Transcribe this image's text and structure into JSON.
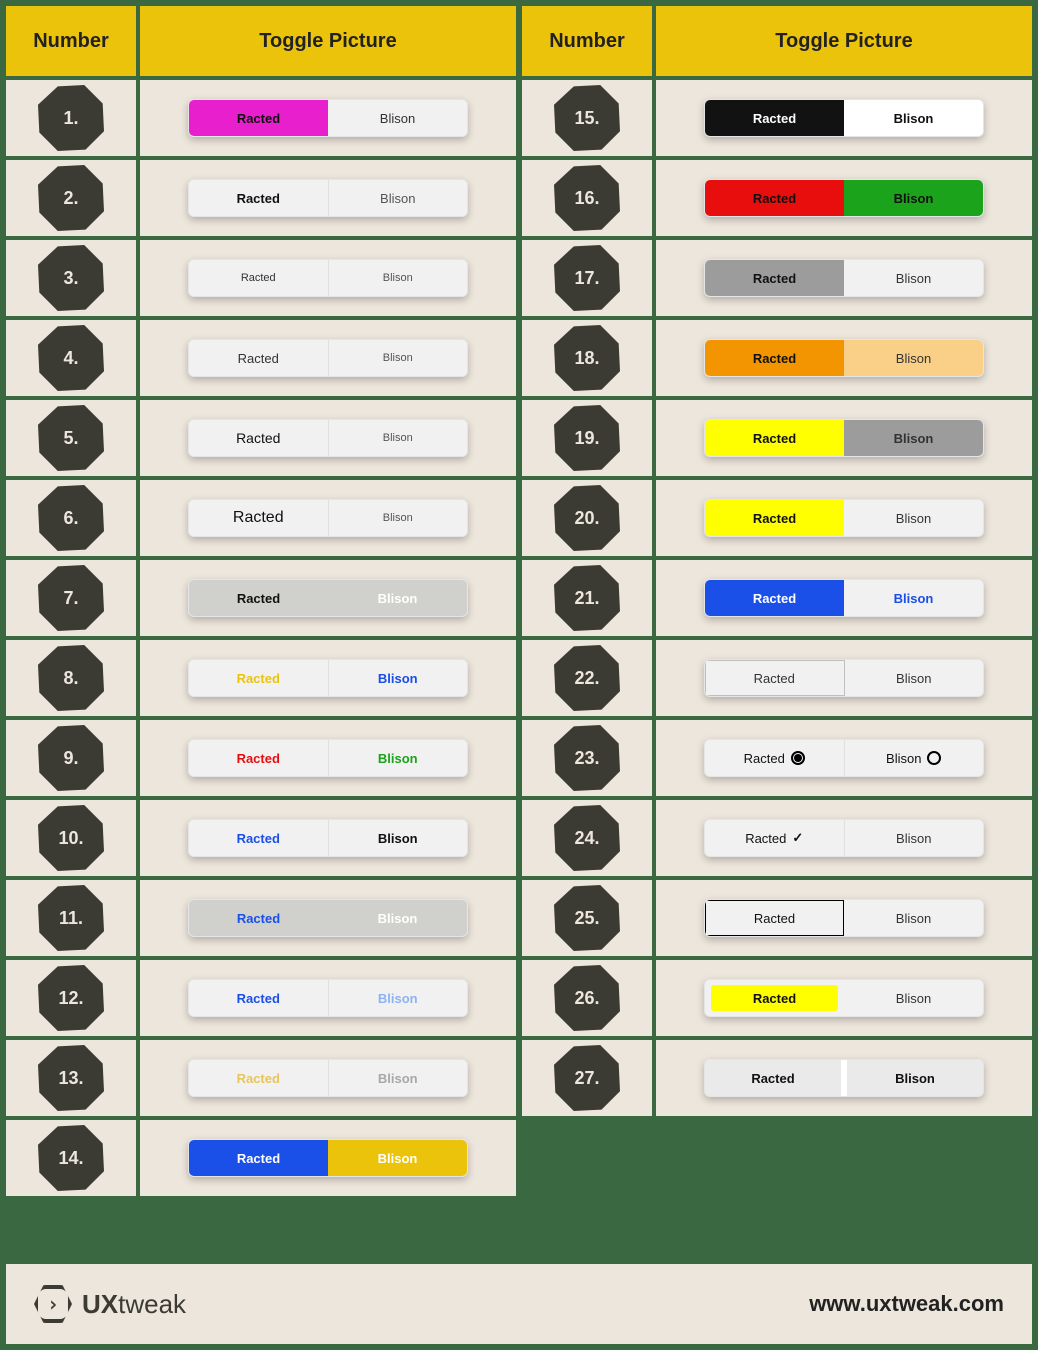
{
  "headers": {
    "number": "Number",
    "picture": "Toggle Picture"
  },
  "opt1": "Racted",
  "opt2": "Blison",
  "rows_left": [
    {
      "n": "1.",
      "left": {
        "bg": "#E81FCD",
        "fg": "#111",
        "fw": "700"
      },
      "right": {
        "bg": "#F1F1F1",
        "fg": "#333",
        "fw": "400"
      }
    },
    {
      "n": "2.",
      "left": {
        "bg": "#F1F1F1",
        "fg": "#111",
        "fw": "700",
        "div": "#E0E0E0"
      },
      "right": {
        "bg": "#F1F1F1",
        "fg": "#555",
        "fw": "400"
      }
    },
    {
      "n": "3.",
      "left": {
        "bg": "#F1F1F1",
        "fg": "#333",
        "fw": "400",
        "fs": "11px",
        "div": "#E0E0E0"
      },
      "right": {
        "bg": "#F1F1F1",
        "fg": "#555",
        "fw": "400",
        "fs": "11px"
      }
    },
    {
      "n": "4.",
      "left": {
        "bg": "#F1F1F1",
        "fg": "#333",
        "fw": "400",
        "div": "#E0E0E0"
      },
      "right": {
        "bg": "#F1F1F1",
        "fg": "#555",
        "fw": "400",
        "fs": "11px"
      }
    },
    {
      "n": "5.",
      "left": {
        "bg": "#F1F1F1",
        "fg": "#111",
        "fw": "400",
        "fs": "14px",
        "div": "#E0E0E0"
      },
      "right": {
        "bg": "#F1F1F1",
        "fg": "#555",
        "fw": "400",
        "fs": "11px"
      }
    },
    {
      "n": "6.",
      "left": {
        "bg": "#F1F1F1",
        "fg": "#111",
        "fw": "400",
        "fs": "16px",
        "div": "#E0E0E0"
      },
      "right": {
        "bg": "#F1F1F1",
        "fg": "#555",
        "fw": "400",
        "fs": "11px"
      }
    },
    {
      "n": "7.",
      "left": {
        "bg": "#D0D0CD",
        "fg": "#111",
        "fw": "700"
      },
      "right": {
        "bg": "#D0D0CD",
        "fg": "#FFFFFF",
        "fw": "700"
      }
    },
    {
      "n": "8.",
      "left": {
        "bg": "#F1F1F1",
        "fg": "#ECC30B",
        "fw": "700",
        "div": "#E0E0E0"
      },
      "right": {
        "bg": "#F1F1F1",
        "fg": "#1A4FE8",
        "fw": "700"
      }
    },
    {
      "n": "9.",
      "left": {
        "bg": "#F1F1F1",
        "fg": "#E80E0E",
        "fw": "700",
        "div": "#E0E0E0"
      },
      "right": {
        "bg": "#F1F1F1",
        "fg": "#1CA31C",
        "fw": "700"
      }
    },
    {
      "n": "10.",
      "left": {
        "bg": "#F1F1F1",
        "fg": "#1A4FE8",
        "fw": "700",
        "div": "#E0E0E0"
      },
      "right": {
        "bg": "#F1F1F1",
        "fg": "#111",
        "fw": "700"
      }
    },
    {
      "n": "11.",
      "left": {
        "bg": "#D0D0CD",
        "fg": "#1A4FE8",
        "fw": "700"
      },
      "right": {
        "bg": "#D0D0CD",
        "fg": "#FFFFFF",
        "fw": "700"
      }
    },
    {
      "n": "12.",
      "left": {
        "bg": "#F1F1F1",
        "fg": "#1A4FE8",
        "fw": "700",
        "div": "#E0E0E0"
      },
      "right": {
        "bg": "#F1F1F1",
        "fg": "#8FB3F2",
        "fw": "700"
      }
    },
    {
      "n": "13.",
      "left": {
        "bg": "#F1F1F1",
        "fg": "#E8C55A",
        "fw": "700",
        "div": "#E0E0E0"
      },
      "right": {
        "bg": "#F1F1F1",
        "fg": "#A8A8A8",
        "fw": "700"
      }
    },
    {
      "n": "14.",
      "left": {
        "bg": "#1A4FE8",
        "fg": "#FFFFFF",
        "fw": "700"
      },
      "right": {
        "bg": "#ECC30B",
        "fg": "#FFFFFF",
        "fw": "700"
      }
    }
  ],
  "rows_right": [
    {
      "n": "15.",
      "left": {
        "bg": "#121212",
        "fg": "#FFFFFF",
        "fw": "700"
      },
      "right": {
        "bg": "#FFFFFF",
        "fg": "#111",
        "fw": "700"
      }
    },
    {
      "n": "16.",
      "left": {
        "bg": "#E80E0E",
        "fg": "#111",
        "fw": "700"
      },
      "right": {
        "bg": "#1CA31C",
        "fg": "#111",
        "fw": "700"
      }
    },
    {
      "n": "17.",
      "left": {
        "bg": "#9C9C9C",
        "fg": "#111",
        "fw": "700"
      },
      "right": {
        "bg": "#F1F1F1",
        "fg": "#333",
        "fw": "400"
      }
    },
    {
      "n": "18.",
      "left": {
        "bg": "#F29500",
        "fg": "#111",
        "fw": "700"
      },
      "right": {
        "bg": "#FAD088",
        "fg": "#333",
        "fw": "400"
      }
    },
    {
      "n": "19.",
      "left": {
        "bg": "#FFFF00",
        "fg": "#111",
        "fw": "700"
      },
      "right": {
        "bg": "#9C9C9C",
        "fg": "#333",
        "fw": "700"
      }
    },
    {
      "n": "20.",
      "left": {
        "bg": "#FFFF00",
        "fg": "#111",
        "fw": "700"
      },
      "right": {
        "bg": "#F1F1F1",
        "fg": "#333",
        "fw": "400"
      }
    },
    {
      "n": "21.",
      "left": {
        "bg": "#1A4FE8",
        "fg": "#FFFFFF",
        "fw": "700"
      },
      "right": {
        "bg": "#F1F1F1",
        "fg": "#1A4FE8",
        "fw": "700"
      }
    },
    {
      "n": "22.",
      "left": {
        "bg": "#F1F1F1",
        "fg": "#333",
        "fw": "400",
        "border": "#BFBFBF",
        "div": "#BFBFBF"
      },
      "right": {
        "bg": "#F1F1F1",
        "fg": "#333",
        "fw": "400"
      }
    },
    {
      "n": "23.",
      "left": {
        "bg": "#F1F1F1",
        "fg": "#111",
        "fw": "400",
        "icon": "radio-filled",
        "div": "#E0E0E0"
      },
      "right": {
        "bg": "#F1F1F1",
        "fg": "#111",
        "fw": "400",
        "icon": "radio-empty"
      }
    },
    {
      "n": "24.",
      "left": {
        "bg": "#F1F1F1",
        "fg": "#111",
        "fw": "400",
        "icon": "check",
        "div": "#E0E0E0"
      },
      "right": {
        "bg": "#F1F1F1",
        "fg": "#333",
        "fw": "400"
      }
    },
    {
      "n": "25.",
      "left": {
        "bg": "#F1F1F1",
        "fg": "#111",
        "fw": "400",
        "border": "#000000"
      },
      "right": {
        "bg": "#F1F1F1",
        "fg": "#333",
        "fw": "400"
      }
    },
    {
      "n": "26.",
      "left": {
        "bg": "#FFFF00",
        "fg": "#111",
        "fw": "700",
        "inset": true
      },
      "right": {
        "bg": "#F1F1F1",
        "fg": "#333",
        "fw": "400"
      }
    },
    {
      "n": "27.",
      "left": {
        "bg": "#EAEAEA",
        "fg": "#111",
        "fw": "700",
        "div": "#FFFFFF",
        "divW": "6px"
      },
      "right": {
        "bg": "#EAEAEA",
        "fg": "#111",
        "fw": "700"
      }
    }
  ],
  "footer": {
    "brand_bold": "UX",
    "brand_light": "tweak",
    "url": "www.uxtweak.com"
  }
}
